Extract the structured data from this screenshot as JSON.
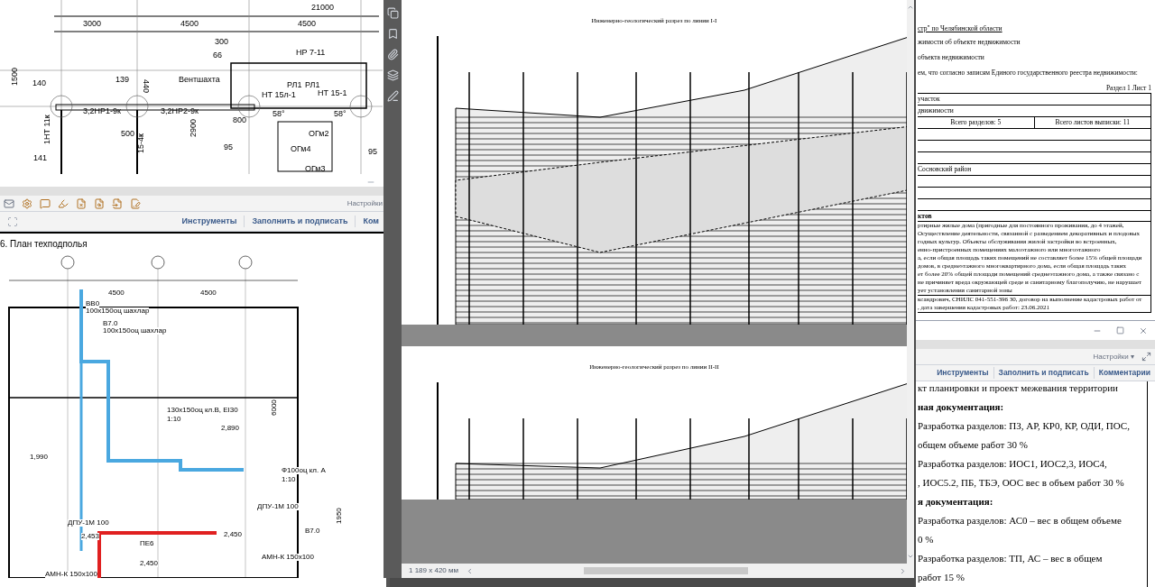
{
  "cad_plan": {
    "labels": [
      "21000",
      "3000",
      "4500",
      "4500",
      "300",
      "66",
      "НР 7-11",
      "140",
      "139",
      "440",
      "Вентшахта",
      "РЛ1",
      "РЛ1",
      "НТ 15л-1",
      "НТ 15-1",
      "1500",
      "3,2НР1-9к",
      "3,2НР2-9к",
      "58°",
      "58°",
      "800",
      "500",
      "2900",
      "1НТ 11к",
      "15-4к",
      "ОГм2",
      "95",
      "ОГм4",
      "95",
      "141",
      "ОГм3"
    ]
  },
  "plan_window": {
    "settings": "Настройки",
    "tabs": [
      "Инструменты",
      "Заполнить и подписать",
      "Ком"
    ],
    "sheet_title": "6. План техподполья",
    "labels": [
      "4500",
      "4500",
      "ВВ0",
      "100х150оц шахлар",
      "В7.0",
      "100х150оц шахлар",
      "130х150оц кл.В, EI30",
      "1:10",
      "1,990",
      "2,890",
      "Ф100оц кл. А",
      "1:10",
      "ДПУ-1М 100",
      "ДПУ-1М 100",
      "2,453",
      "2,450",
      "ПЕ6",
      "2,450",
      "В7.0",
      "АМН-К 150х100",
      "АМН-К 150х100",
      "6000",
      "1950"
    ]
  },
  "section_viewer": {
    "sheets": [
      {
        "title": "Инженерно-геологический разрез по линии I-I"
      },
      {
        "title": "Инженерно-геологический разрез по линии II-II"
      }
    ],
    "page_size": "1 189 x 420 мм"
  },
  "extract_window": {
    "lines": [
      {
        "kind": "heading",
        "text": "стр\" по Челябинской области"
      },
      {
        "kind": "line",
        "text": "жимости об объекте недвижимости"
      },
      {
        "kind": "line",
        "text": "объекта недвижимости"
      },
      {
        "kind": "line",
        "text": "ем, что согласно записям Единого государственного реестра недвижимости:"
      },
      {
        "kind": "right",
        "text": "Раздел 1 Лист 1"
      }
    ],
    "rows": [
      {
        "cells": [
          "участок"
        ]
      },
      {
        "cells": [
          "движимости"
        ]
      },
      {
        "cells": [
          "Всего разделов: 5",
          "Всего листов выписки: 11"
        ]
      },
      {
        "cells": [
          "Сосновский район"
        ]
      }
    ],
    "section": "ктов",
    "paragraph": [
      "ртирные жилые дома (пригодные для постоянного проживания, до 4 этажей,",
      "Осуществление деятельности, связанной с разведением декоративных и плодовых",
      "годных культур. Объекты обслуживания жилой застройки во встроенных,",
      "енно-пристроенных помещениях малоэтажного или многоэтажного",
      "а, если общая площадь таких помещений не составляет более 15% общей площади",
      "домов, в среднеэтажного многоквартирного дома, если общая площадь таких",
      "ет более 20% общей площади помещений среднеэтажного дома, а также связано с",
      "не причиняет вреда окружающей среде и санитарному благополучию, не нарушает",
      "ует установления санитарной зоны"
    ],
    "engineer": [
      "ксандрович, СНИЛС 041-551-396 30, договор на выполнение кадастровых работ от",
      ", дата завершения кадастровых работ: 23.06.2021"
    ]
  },
  "doc_window": {
    "settings": "Настройки ▾",
    "tabs": [
      "Инструменты",
      "Заполнить и подписать",
      "Комментарии"
    ],
    "lines": [
      {
        "kind": "text",
        "text": "кт планировки и проект межевания территории"
      },
      {
        "kind": "heading",
        "text": "ная документация:"
      },
      {
        "kind": "text",
        "text": "Разработка разделов: ПЗ, АР, КР0, КР, ОДИ, ПОС,"
      },
      {
        "kind": "text",
        "text": "общем объеме работ 30 %"
      },
      {
        "kind": "text",
        "text": "Разработка разделов: ИОС1, ИОС2,3, ИОС4,"
      },
      {
        "kind": "text",
        "text": ", ИОС5.2, ПБ, ТБЭ, ООС   вес в объем работ 30 %"
      },
      {
        "kind": "heading",
        "text": "я документация:"
      },
      {
        "kind": "text",
        "text": "Разработка разделов: АС0 – вес в общем объеме"
      },
      {
        "kind": "text",
        "text": "0 %"
      },
      {
        "kind": "text",
        "text": "Разработка разделов: ТП, АС – вес в общем"
      },
      {
        "kind": "text",
        "text": "работ 15 %"
      }
    ]
  }
}
